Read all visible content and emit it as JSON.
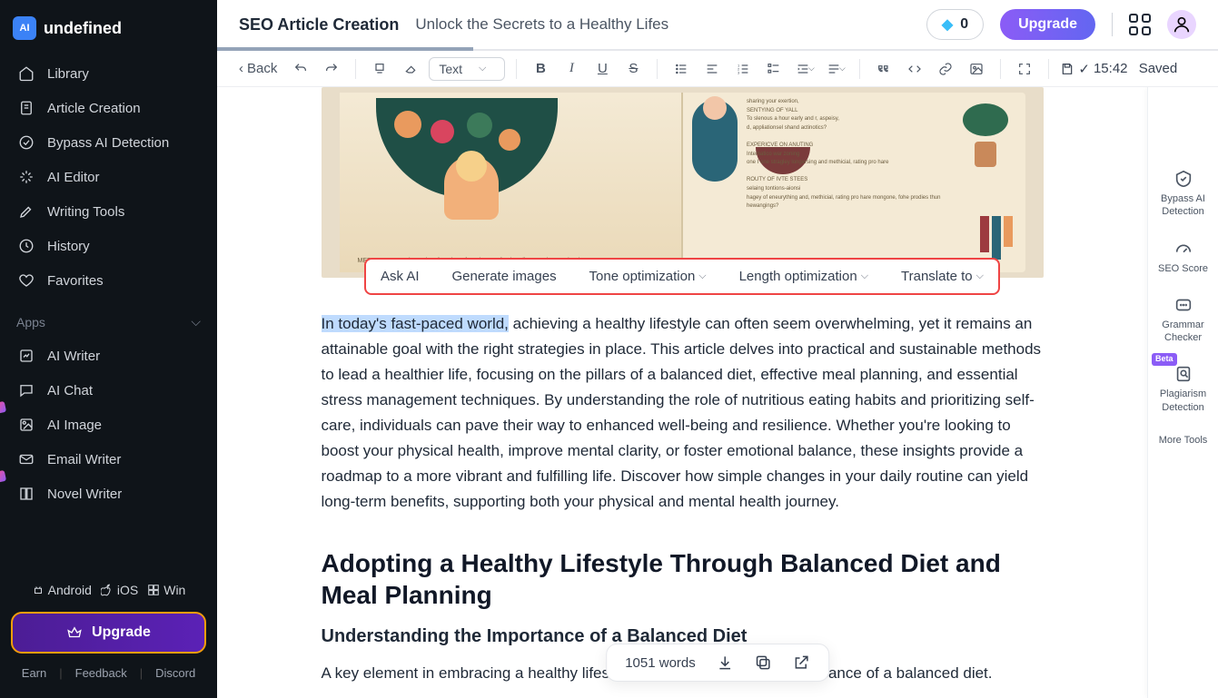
{
  "brand": "undefined",
  "sidebar": {
    "items": [
      "Library",
      "Article Creation",
      "Bypass AI Detection",
      "AI Editor",
      "Writing Tools",
      "History",
      "Favorites"
    ],
    "apps_label": "Apps",
    "apps": [
      "AI Writer",
      "AI Chat",
      "AI Image",
      "Email Writer",
      "Novel Writer"
    ],
    "platforms": [
      "Android",
      "iOS",
      "Win"
    ],
    "upgrade": "Upgrade",
    "links": [
      "Earn",
      "Feedback",
      "Discord"
    ]
  },
  "header": {
    "crumb1": "SEO Article Creation",
    "crumb2": "Unlock the Secrets to a Healthy Lifes",
    "credits": "0",
    "upgrade": "Upgrade"
  },
  "toolbar": {
    "back": "Back",
    "text_select": "Text",
    "saved_time": "15:42",
    "saved_label": "Saved"
  },
  "ai_bar": {
    "ask": "Ask AI",
    "gen": "Generate images",
    "tone": "Tone optimization",
    "length": "Length optimization",
    "translate": "Translate to"
  },
  "article": {
    "p1_hl": "In today's fast-paced world,",
    "p1_rest": " achieving a healthy lifestyle can often seem overwhelming, yet it remains an attainable goal with the right strategies in place. This article delves into practical and sustainable methods to lead a healthier life, focusing on the pillars of a balanced diet, effective meal planning, and essential stress management techniques. By understanding the role of nutritious eating habits and prioritizing self-care, individuals can pave their way to enhanced well-being and resilience. Whether you're looking to boost your physical health, improve mental clarity, or foster emotional balance, these insights provide a roadmap to a more vibrant and fulfilling life. Discover how simple changes in your daily routine can yield long-term benefits, supporting both your physical and mental health journey.",
    "h2": "Adopting a Healthy Lifestyle Through Balanced Diet and Meal Planning",
    "h3": "Understanding the Importance of a Balanced Diet",
    "p2": "A key element in embracing a healthy lifestyle is understanding the significance of a balanced diet."
  },
  "right_panel": {
    "bypass": "Bypass AI Detection",
    "seo": "SEO Score",
    "grammar": "Grammar Checker",
    "plag": "Plagiarism Detection",
    "beta": "Beta",
    "more": "More Tools"
  },
  "floatbar": {
    "words": "1051 words"
  }
}
